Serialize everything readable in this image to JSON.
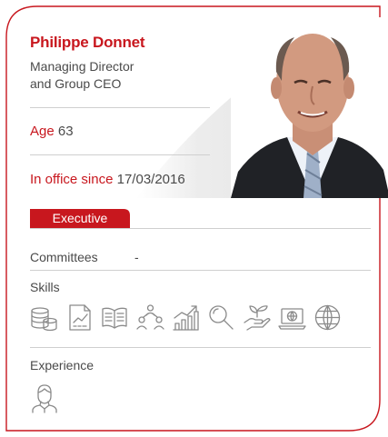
{
  "profile": {
    "name": "Philippe Donnet",
    "role_line1": "Managing Director",
    "role_line2": "and Group CEO",
    "age_label": "Age",
    "age_value": "63",
    "office_label": "In office since",
    "office_value": "17/03/2016",
    "type_tag": "Executive"
  },
  "committees": {
    "label": "Committees",
    "value": "-"
  },
  "skills": {
    "label": "Skills",
    "icons": [
      "coins-icon",
      "financial-report-icon",
      "open-book-icon",
      "team-network-icon",
      "growth-chart-icon",
      "magnifier-icon",
      "hand-plant-icon",
      "laptop-globe-icon",
      "globe-icon"
    ]
  },
  "experience": {
    "label": "Experience",
    "icons": [
      "person-portrait-icon"
    ]
  },
  "colors": {
    "accent": "#c8171e",
    "text": "#4a4a4a",
    "icon": "#8a8a8a",
    "divider": "#cfcfcf"
  }
}
